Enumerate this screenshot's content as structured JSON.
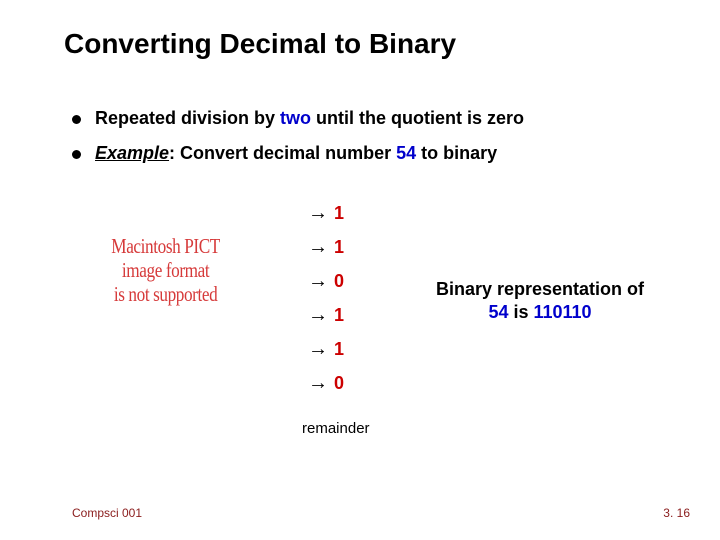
{
  "title": "Converting Decimal to Binary",
  "bullets": {
    "b1_pre": "Repeated division by ",
    "b1_emph": "two",
    "b1_post": " until the quotient is zero",
    "b2_word": "Example",
    "b2_mid": ": Convert decimal number ",
    "b2_num": "54",
    "b2_post": " to binary"
  },
  "pict": {
    "l1": "Macintosh PICT",
    "l2": "image format",
    "l3": "is not supported"
  },
  "arrow_symbol": "→",
  "remainders": [
    "1",
    "1",
    "0",
    "1",
    "1",
    "0"
  ],
  "rep": {
    "line1": "Binary representation of",
    "pre": "54",
    "mid": " is ",
    "val": "110110"
  },
  "remainder_label": "remainder",
  "footer": {
    "left": "Compsci 001",
    "right": "3. 16"
  }
}
